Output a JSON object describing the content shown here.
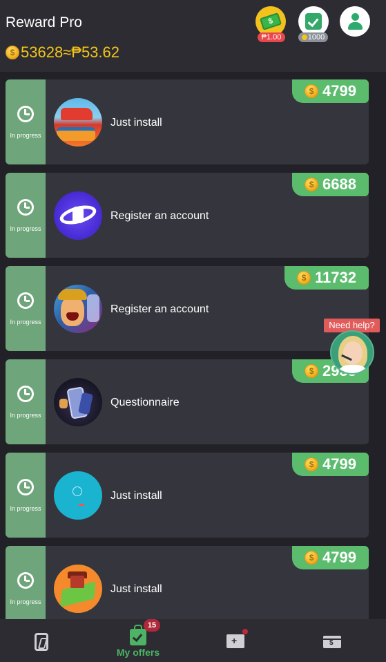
{
  "header": {
    "app_title": "Reward Pro",
    "coin_balance": "53628",
    "approx_symbol": "≈",
    "peso_balance": "₱53.62",
    "cash_badge": "₱1.00",
    "checkin_badge": "1000",
    "cash_icon_text": "$"
  },
  "offers": [
    {
      "status": "In progress",
      "title": "Just install",
      "reward": "4799"
    },
    {
      "status": "In progress",
      "title": "Register an account",
      "reward": "6688"
    },
    {
      "status": "In progress",
      "title": "Register an account",
      "reward": "11732"
    },
    {
      "status": "In progress",
      "title": "Questionnaire",
      "reward": "2935"
    },
    {
      "status": "In progress",
      "title": "Just install",
      "reward": "4799"
    },
    {
      "status": "In progress",
      "title": "Just install",
      "reward": "4799"
    }
  ],
  "help": {
    "label": "Need help?"
  },
  "bottom_nav": {
    "my_offers_label": "My offers",
    "my_offers_badge": "15"
  },
  "colors": {
    "background": "#212127",
    "card": "#35353d",
    "status_strip": "#6fa57a",
    "reward_pill": "#5bbc6e",
    "accent_green": "#4cb463",
    "coin_gold": "#f5c518"
  }
}
